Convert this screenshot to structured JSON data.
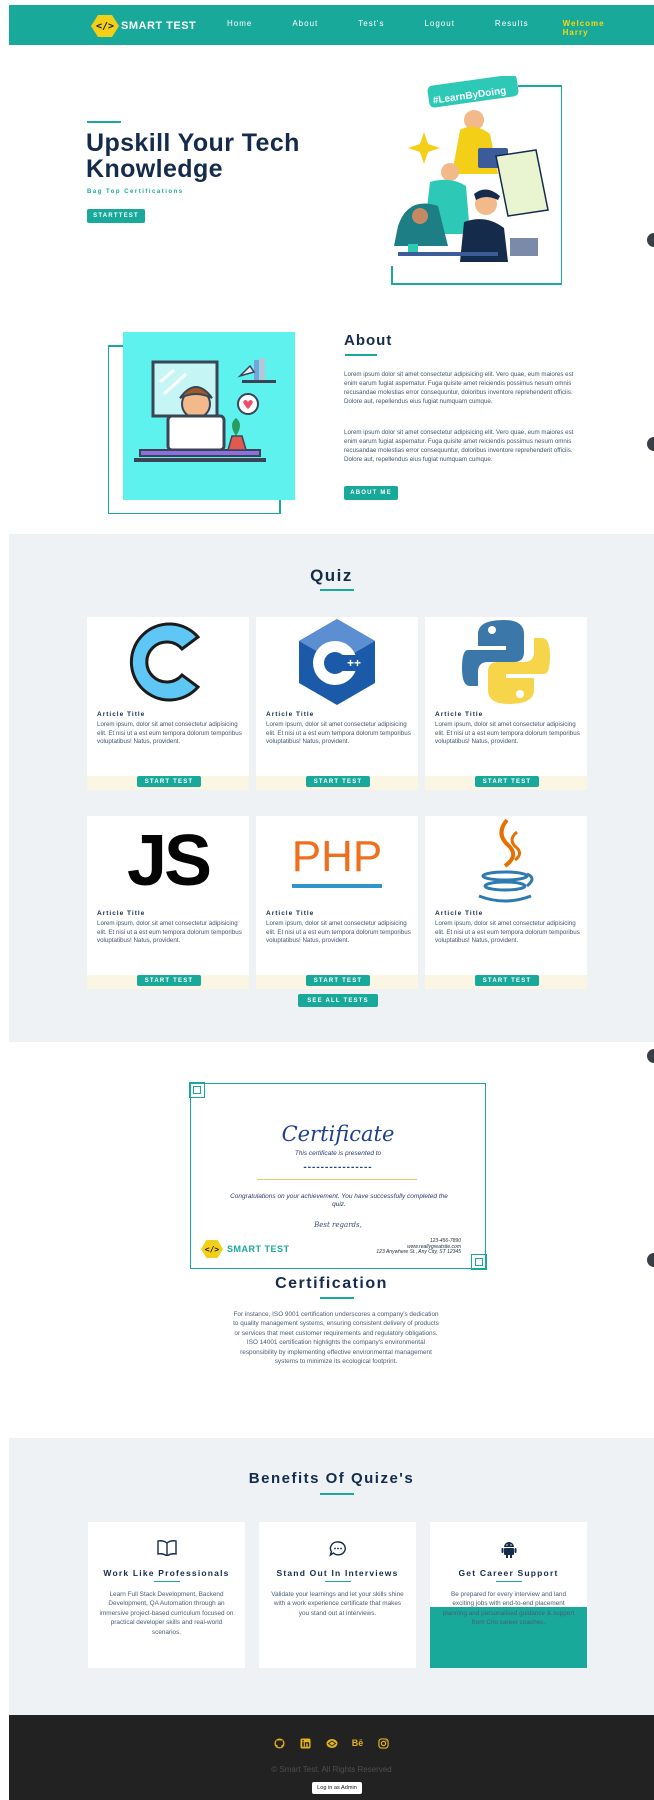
{
  "nav": {
    "logo_glyph": "</>",
    "logo_text": "SMART TEST",
    "links": [
      "Home",
      "About",
      "Test's",
      "Logout",
      "Results"
    ],
    "welcome": "Welcome Harry"
  },
  "hero": {
    "title": "Upskill Your Tech Knowledge",
    "subtitle": "Bag Top Certifications",
    "button": "STARTTEST",
    "art_badge": "#LearnByDoing"
  },
  "about": {
    "title": "About",
    "paragraphs": [
      "Lorem ipsum dolor sit amet consectetur adipisicing elit. Vero quae, eum maiores est enim earum fugiat aspernatur. Fuga quisite amet reiciendis possimus nesum omnis recusandae molestias error consequuntur, doloribus inventore reprehenderit officiis. Dolore aut, repellendus eius fugiat numquam cumque.",
      "Lorem ipsum dolor sit amet consectetur adipisicing elit. Vero quae, eum maiores est enim earum fugiat aspernatur. Fuga quisite amet reiciendis possimus nesum omnis recusandae molestias error consequuntur, doloribus inventore reprehenderit officiis. Dolore aut, repellendus eius fugiat numquam cumque."
    ],
    "button": "ABOUT ME"
  },
  "quiz": {
    "title": "Quiz",
    "cards": [
      {
        "logo": "C",
        "title": "Article Title",
        "text": "Lorem ipsum, dolor sit amet consectetur adipisicing elit. Et nisi ut a est eum tempora dolorum temporibus voluptatibus! Natus, provident.",
        "button": "START TEST"
      },
      {
        "logo": "C++",
        "title": "Article Title",
        "text": "Lorem ipsum, dolor sit amet consectetur adipisicing elit. Et nisi ut a est eum tempora dolorum temporibus voluptatibus! Natus, provident.",
        "button": "START TEST"
      },
      {
        "logo": "Python",
        "title": "Article Title",
        "text": "Lorem ipsum, dolor sit amet consectetur adipisicing elit. Et nisi ut a est eum tempora dolorum temporibus voluptatibus! Natus, provident.",
        "button": "START TEST"
      },
      {
        "logo": "JS",
        "title": "Article Title",
        "text": "Lorem ipsum, dolor sit amet consectetur adipisicing elit. Et nisi ut a est eum tempora dolorum temporibus voluptatibus! Natus, provident.",
        "button": "START TEST"
      },
      {
        "logo": "PHP",
        "title": "Article Title",
        "text": "Lorem ipsum, dolor sit amet consectetur adipisicing elit. Et nisi ut a est eum tempora dolorum temporibus voluptatibus! Natus, provident.",
        "button": "START TEST"
      },
      {
        "logo": "Java",
        "title": "Article Title",
        "text": "Lorem ipsum, dolor sit amet consectetur adipisicing elit. Et nisi ut a est eum tempora dolorum temporibus voluptatibus! Natus, provident.",
        "button": "START TEST"
      }
    ],
    "see_all": "SEE ALL TESTS"
  },
  "certificate": {
    "title": "Certificate",
    "presented": "This certificate is presented to",
    "name_line": "----------------",
    "congrats": "Congratulations on your achievement. You have successfully completed the quiz.",
    "regards": "Best regards,",
    "phone": "123-456-7890",
    "site": "www.reallygreatsite.com",
    "address": "123 Anywhere St., Any City, ST 12345",
    "brand": "SMART TEST"
  },
  "certification": {
    "title": "Certification",
    "text": "For instance, ISO 9001 certification underscores a company's dedication to quality management systems, ensuring consistent delivery of products or services that meet customer requirements and regulatory obligations. ISO 14001 certification highlights the company's environmental responsibility by implementing effective environmental management systems to minimize its ecological footprint."
  },
  "benefits": {
    "title": "Benefits Of Quize's",
    "items": [
      {
        "icon": "book-icon",
        "title": "Work Like Professionals",
        "text": "Learn Full Stack Development, Backend Development, QA Automation through an immersive project-based curriculum focused on practical developer skills and real-world scenarios."
      },
      {
        "icon": "chat-icon",
        "title": "Stand Out In Interviews",
        "text": "Validate your learnings and let your skills shine with a work experience certificate that makes you stand out at interviews."
      },
      {
        "icon": "android-icon",
        "title": "Get Career Support",
        "text": "Be prepared for every interview and land exciting jobs with end-to-end placement planning and personalised guidance & support from Crio career coaches."
      }
    ]
  },
  "footer": {
    "icons": [
      "github-icon",
      "linkedin-icon",
      "codepen-icon",
      "behance-icon",
      "instagram-icon"
    ],
    "behance_label": "Bē",
    "copyright": "© Smart Test. All Rights Reserved",
    "admin_button": "Log in as Admin"
  },
  "colors": {
    "primary": "#19a99b",
    "navy": "#142b4c",
    "accent_yellow": "#f3cf17",
    "section_bg": "#eef2f4",
    "footer_bg": "#222222"
  }
}
